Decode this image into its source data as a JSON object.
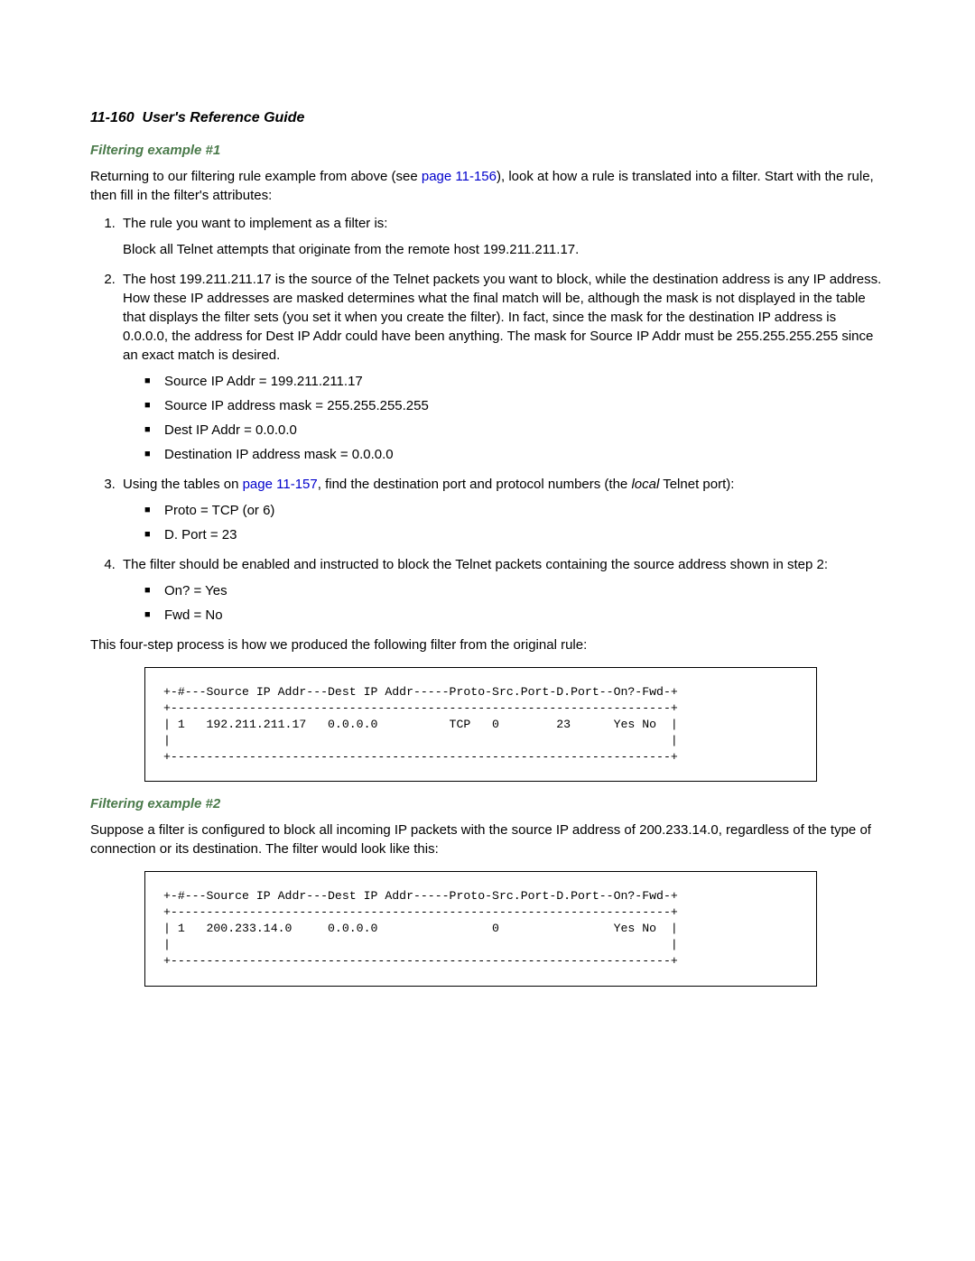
{
  "page_header": {
    "page_num": "11-160",
    "title": "User's Reference Guide"
  },
  "section1": {
    "title": "Filtering example #1",
    "intro_a": "Returning to our filtering rule example from above (see ",
    "intro_link": "page 11-156",
    "intro_b": "), look at how a rule is translated into a filter. Start with the rule, then fill in the filter's attributes:",
    "step1_a": "The rule you want to implement as a filter is:",
    "step1_b": "Block all Telnet attempts that originate from the remote host 199.211.211.17.",
    "step2": "The host 199.211.211.17 is the source of the Telnet packets you want to block, while the destination address is any IP address. How these IP addresses are masked determines what the final match will be, although the mask is not displayed in the table that displays the filter sets (you set it when you create the filter). In fact, since the mask for the destination IP address is 0.0.0.0, the address for Dest IP Addr could have been anything. The mask for Source IP Addr must be 255.255.255.255 since an exact match is desired.",
    "step2_bullets": {
      "b1": "Source IP Addr = 199.211.211.17",
      "b2": "Source IP address mask = 255.255.255.255",
      "b3": "Dest IP Addr = 0.0.0.0",
      "b4": "Destination IP address mask = 0.0.0.0"
    },
    "step3_a": "Using the tables on ",
    "step3_link": "page 11-157",
    "step3_b": ", find the destination port and protocol numbers (the ",
    "step3_ital": "local",
    "step3_c": " Telnet port):",
    "step3_bullets": {
      "b1": "Proto = TCP (or 6)",
      "b2": "D. Port = 23"
    },
    "step4": "The filter should be enabled and instructed to block the Telnet packets containing the source address shown in step 2:",
    "step4_bullets": {
      "b1": "On? = Yes",
      "b2": "Fwd = No"
    },
    "outro": "This four-step process is how we produced the following filter from the original rule:",
    "filter_table": "+-#---Source IP Addr---Dest IP Addr-----Proto-Src.Port-D.Port--On?-Fwd-+\n+----------------------------------------------------------------------+\n| 1   192.211.211.17   0.0.0.0          TCP   0        23      Yes No  |\n|                                                                      |\n+----------------------------------------------------------------------+"
  },
  "section2": {
    "title": "Filtering example #2",
    "intro": "Suppose a filter is configured to block all incoming IP packets with the source IP address of 200.233.14.0, regardless of the type of connection or its destination. The filter would look like this:",
    "filter_table": "+-#---Source IP Addr---Dest IP Addr-----Proto-Src.Port-D.Port--On?-Fwd-+\n+----------------------------------------------------------------------+\n| 1   200.233.14.0     0.0.0.0                0                Yes No  |\n|                                                                      |\n+----------------------------------------------------------------------+"
  },
  "chart_data": [
    {
      "type": "table",
      "title": "Filter table example 1",
      "columns": [
        "#",
        "Source IP Addr",
        "Dest IP Addr",
        "Proto",
        "Src.Port",
        "D.Port",
        "On?",
        "Fwd"
      ],
      "rows": [
        [
          "1",
          "192.211.211.17",
          "0.0.0.0",
          "TCP",
          "0",
          "23",
          "Yes",
          "No"
        ]
      ]
    },
    {
      "type": "table",
      "title": "Filter table example 2",
      "columns": [
        "#",
        "Source IP Addr",
        "Dest IP Addr",
        "Proto",
        "Src.Port",
        "D.Port",
        "On?",
        "Fwd"
      ],
      "rows": [
        [
          "1",
          "200.233.14.0",
          "0.0.0.0",
          "",
          "0",
          "",
          "Yes",
          "No"
        ]
      ]
    }
  ]
}
